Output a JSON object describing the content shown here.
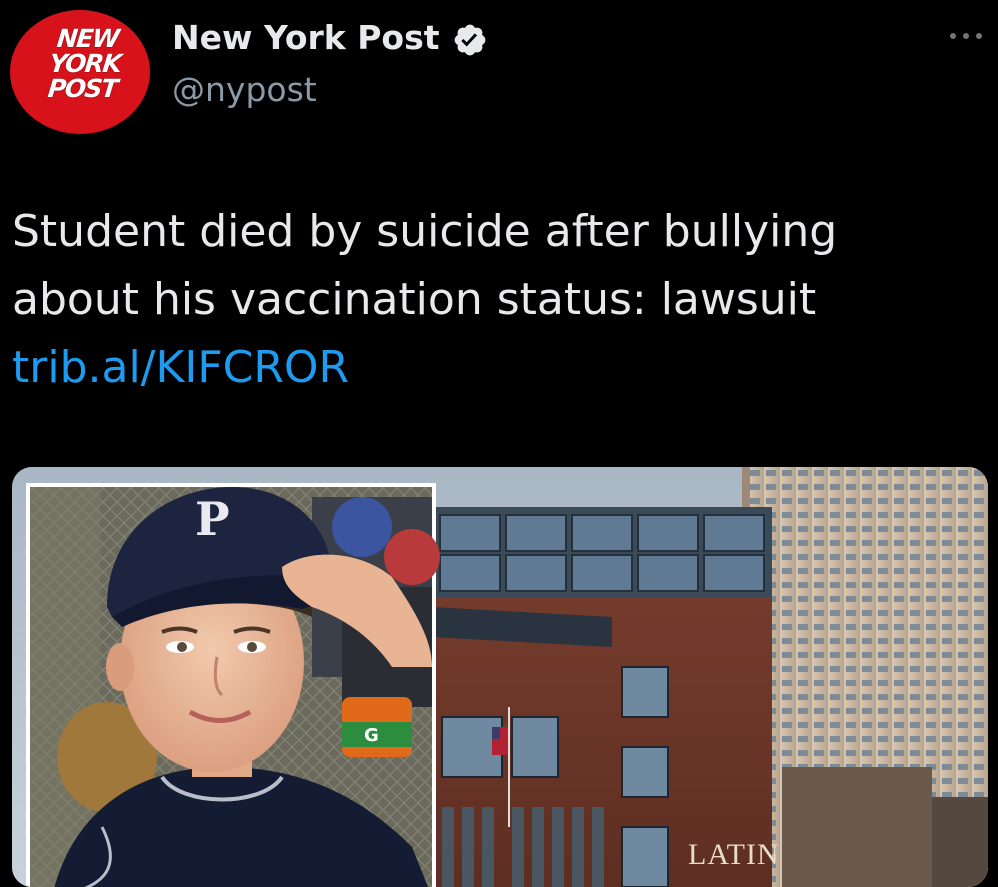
{
  "account": {
    "display_name": "New York Post",
    "handle": "@nypost",
    "verified": true,
    "avatar_logo": [
      "NEW",
      "YORK",
      "POST"
    ],
    "avatar_color": "#d8121a"
  },
  "tweet": {
    "text_lines": [
      "Student died by suicide after bullying",
      "about his vaccination status: lawsuit"
    ],
    "link": "trib.al/KIFCROR",
    "link_color": "#1d9bf0"
  },
  "media": {
    "cap_letter": "P",
    "bottle_letter": "G",
    "building_sign": "LATIN"
  },
  "icons": {
    "verified": "verified-badge-icon",
    "more": "more-horizontal-icon"
  }
}
